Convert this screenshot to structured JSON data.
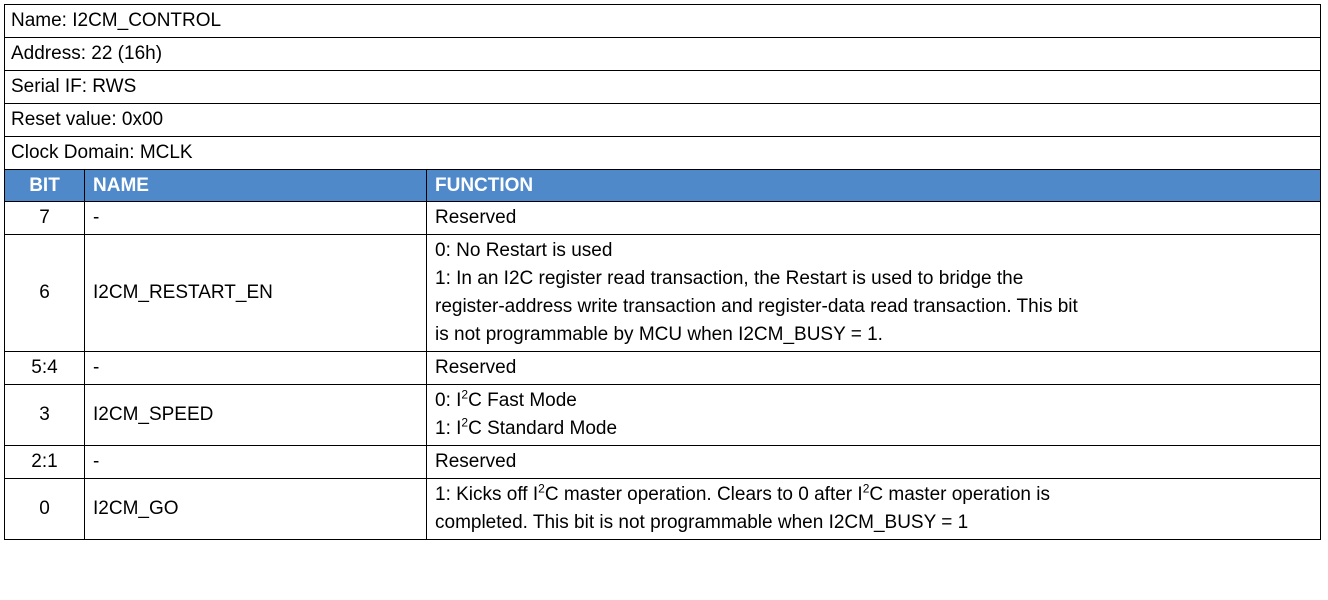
{
  "register": {
    "name_line": "Name: I2CM_CONTROL",
    "address_line": "Address: 22 (16h)",
    "serial_line": "Serial IF: RWS",
    "reset_line": "Reset value: 0x00",
    "clock_line": "Clock Domain: MCLK"
  },
  "table": {
    "headers": {
      "bit": "BIT",
      "name": "NAME",
      "function": "FUNCTION"
    },
    "rows": [
      {
        "bit": "7",
        "name": "-",
        "function": [
          "Reserved"
        ]
      },
      {
        "bit": "6",
        "name": "I2CM_RESTART_EN",
        "function": [
          "0: No Restart is used",
          "1: In an I2C register read transaction, the Restart is used to bridge the",
          "register-address write transaction and register-data read transaction. This bit",
          "is not programmable by MCU when I2CM_BUSY = 1."
        ]
      },
      {
        "bit": "5:4",
        "name": "-",
        "function": [
          "Reserved"
        ]
      },
      {
        "bit": "3",
        "name": "I2CM_SPEED",
        "function": [
          {
            "pre": "0: I",
            "sup": "2",
            "post": "C Fast Mode"
          },
          {
            "pre": "1: I",
            "sup": "2",
            "post": "C Standard Mode"
          }
        ]
      },
      {
        "bit": "2:1",
        "name": "-",
        "function": [
          "Reserved"
        ]
      },
      {
        "bit": "0",
        "name": "I2CM_GO",
        "function": [
          {
            "pre": "1: Kicks off I",
            "sup": "2",
            "mid": "C master operation. Clears to 0 after I",
            "sup2": "2",
            "post": "C master operation is"
          },
          "completed. This bit is not programmable when I2CM_BUSY = 1"
        ]
      }
    ]
  }
}
